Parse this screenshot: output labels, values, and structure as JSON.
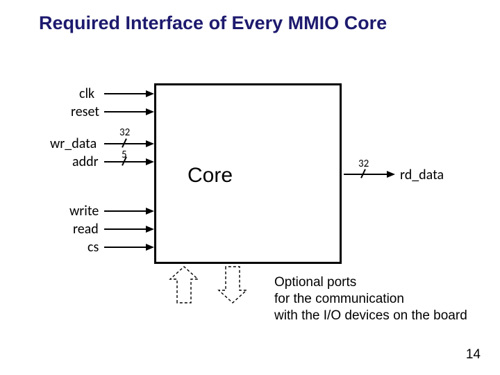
{
  "title": "Required Interface of Every MMIO Core",
  "core": {
    "label": "Core"
  },
  "inputs": [
    {
      "name": "clk"
    },
    {
      "name": "reset"
    },
    {
      "name": "wr_data",
      "width": "32"
    },
    {
      "name": "addr",
      "width": "5"
    },
    {
      "name": "write"
    },
    {
      "name": "read"
    },
    {
      "name": "cs"
    }
  ],
  "outputs": [
    {
      "name": "rd_data",
      "width": "32"
    }
  ],
  "caption": {
    "line1": "Optional ports",
    "line2": "for the communication",
    "line3": "with the I/O devices on the board"
  },
  "page_number": "14"
}
